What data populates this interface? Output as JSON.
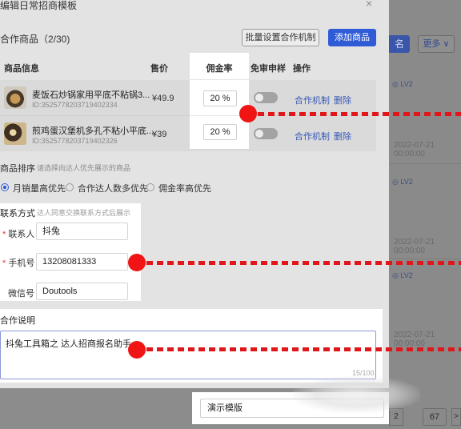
{
  "modal": {
    "title": "编辑日常招商模板",
    "close_icon": "×"
  },
  "goods": {
    "title": "合作商品（2/30)",
    "batch_button": "批量设置合作机制",
    "add_button": "添加商品",
    "columns": {
      "info": "商品信息",
      "price": "售价",
      "commission": "佣金率",
      "free_sample": "免审申样",
      "actions": "操作"
    },
    "rows": [
      {
        "name": "麦饭石炒锅家用平底不粘锅3...",
        "id": "ID:3525778203719402334",
        "price": "¥49.9",
        "commission": "20 %",
        "action_mechanism": "合作机制",
        "action_delete": "删除"
      },
      {
        "name": "煎鸡蛋汉堡机多孔不粘小平底...",
        "id": "ID:3525778203719402326",
        "price": "¥39",
        "commission": "20 %",
        "action_mechanism": "合作机制",
        "action_delete": "删除"
      }
    ]
  },
  "sort": {
    "title": "商品排序",
    "hint": "请选择向达人优先展示的商品",
    "options": [
      "月销量高优先",
      "合作达人数多优先",
      "佣金率高优先"
    ],
    "selected": "月销量高优先"
  },
  "contact": {
    "title": "联系方式",
    "hint": "达人同意交换联系方式后展示",
    "contact_label": "联系人",
    "contact_value": "抖兔",
    "phone_label": "手机号",
    "phone_value": "13208081333",
    "wechat_label": "微信号",
    "wechat_value": "Doutools"
  },
  "cooperation": {
    "title": "合作说明",
    "value": "抖兔工具箱之 达人招商报名助手",
    "count": "15/100"
  },
  "template_name": {
    "value": "演示模版"
  },
  "background": {
    "blue_button": "名",
    "more_button": "更多 ∨",
    "tag": "LV2",
    "date": "2022-07-21 00:00:00",
    "page_number": "67",
    "page_left": "2",
    "page_arrow": ">"
  },
  "colors": {
    "accent": "#2f5bd6",
    "annotation": "#f01414",
    "link": "#3a59b7"
  }
}
